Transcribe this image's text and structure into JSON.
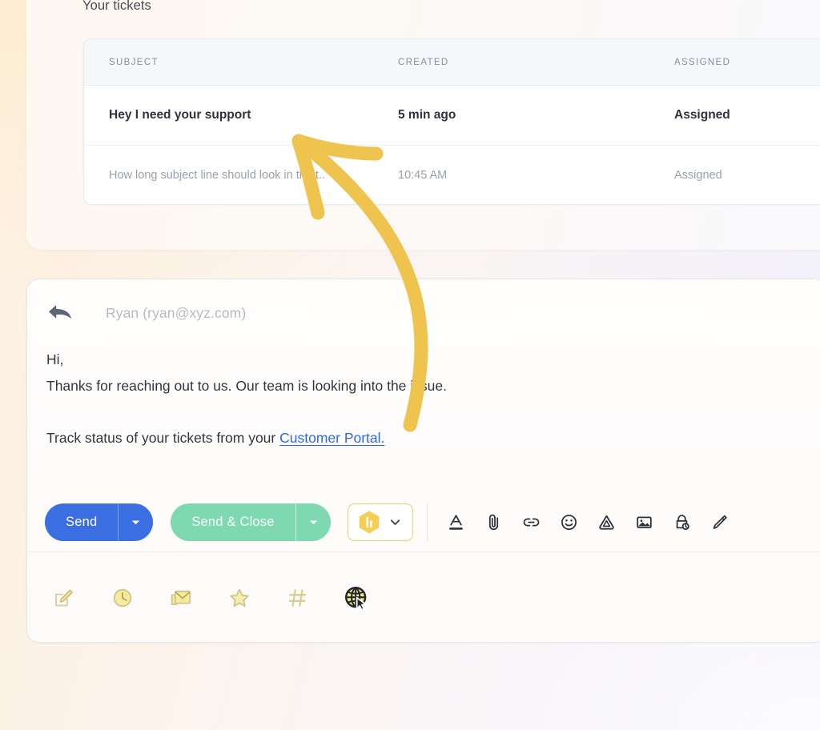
{
  "panel": {
    "title": "Your tickets"
  },
  "table": {
    "columns": [
      "SUBJECT",
      "CREATED",
      "ASSIGNED"
    ],
    "rows": [
      {
        "subject": "Hey I need your support",
        "created": "5 min ago",
        "assigned": "Assigned",
        "state": "active"
      },
      {
        "subject": "How long subject line should look in the t..",
        "created": "10:45 AM",
        "assigned": "Assigned",
        "state": "read"
      }
    ]
  },
  "composer": {
    "reply_icon": "reply-arrow-icon",
    "recipient": "Ryan (ryan@xyz.com)",
    "body": {
      "greeting": "Hi,",
      "line1": "Thanks for reaching out to us. Our team is looking into the issue.",
      "line2_prefix": "Track status of your tickets from your ",
      "link_text": "Customer Portal."
    },
    "actions": {
      "send_label": "Send",
      "send_close_label": "Send & Close",
      "send_color": "#3b6ee0",
      "send_close_color": "#7fd9b0",
      "brand_color": "#f2cf5e",
      "link_color": "#2d6ae0",
      "caret_icon": "chevron-down-icon",
      "brand_icon": "hexagon-h-logo-icon",
      "brand_caret_icon": "chevron-down-icon"
    },
    "format_icons": [
      {
        "name": "text-format-icon",
        "label": "Formatting options"
      },
      {
        "name": "attachment-paperclip-icon",
        "label": "Attach files"
      },
      {
        "name": "insert-link-icon",
        "label": "Insert link"
      },
      {
        "name": "emoji-icon",
        "label": "Insert emoji"
      },
      {
        "name": "google-drive-icon",
        "label": "Insert files using Drive"
      },
      {
        "name": "insert-image-icon",
        "label": "Insert photo"
      },
      {
        "name": "confidential-mode-lock-clock-icon",
        "label": "Confidential mode"
      },
      {
        "name": "signature-pen-icon",
        "label": "Insert signature"
      }
    ],
    "bottom_icons": [
      {
        "name": "compose-note-icon",
        "label": "Compose note"
      },
      {
        "name": "clock-icon",
        "label": "Schedule"
      },
      {
        "name": "mail-icon",
        "label": "Mail"
      },
      {
        "name": "star-icon",
        "label": "Star"
      },
      {
        "name": "hashtag-icon",
        "label": "Tag"
      },
      {
        "name": "globe-cursor-icon",
        "label": "Web widget"
      }
    ]
  },
  "annotation": {
    "arrow_color": "#efc44c",
    "points_to": "Hey I need your support"
  }
}
